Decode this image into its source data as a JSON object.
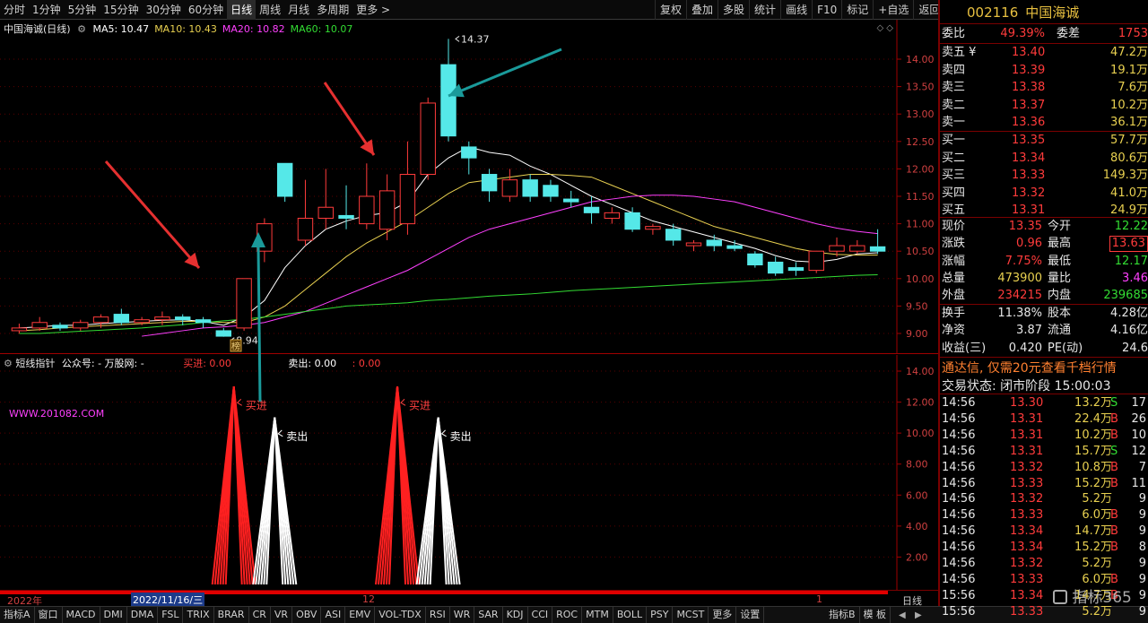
{
  "toolbar": {
    "tabs": [
      "分时",
      "1分钟",
      "5分钟",
      "15分钟",
      "30分钟",
      "60分钟",
      "日线",
      "周线",
      "月线",
      "多周期",
      "更多 >"
    ],
    "active_tab": "日线",
    "tools": [
      "复权",
      "叠加",
      "多股",
      "统计",
      "画线",
      "F10",
      "标记",
      "+自选",
      "返回"
    ]
  },
  "main": {
    "title": "中国海诚(日线)",
    "ma": [
      {
        "label": "MA5: 10.47",
        "color": "#ffffff"
      },
      {
        "label": "MA10: 10.43",
        "color": "#e8d050"
      },
      {
        "label": "MA20: 10.82",
        "color": "#ff40ff"
      },
      {
        "label": "MA60: 10.07",
        "color": "#33dd33"
      }
    ],
    "high_label": "14.37",
    "low_label": "8.94",
    "badge": "榜",
    "y_ticks": [
      "14.00",
      "13.50",
      "13.00",
      "12.50",
      "12.00",
      "11.50",
      "11.00",
      "10.50",
      "10.00",
      "9.50",
      "9.00"
    ],
    "y_values": [
      14.0,
      13.5,
      13.0,
      12.5,
      12.0,
      11.5,
      11.0,
      10.5,
      10.0,
      9.5,
      9.0
    ],
    "colors": {
      "up": "#ff3b3b",
      "down": "#55e8e8",
      "arrow_red": "#e53030",
      "arrow_teal": "#1a9a9a"
    },
    "candles": [
      [
        9.05,
        9.1,
        9.0,
        9.18
      ],
      [
        9.1,
        9.2,
        9.05,
        9.3
      ],
      [
        9.15,
        9.1,
        9.05,
        9.2
      ],
      [
        9.1,
        9.2,
        9.05,
        9.25
      ],
      [
        9.2,
        9.3,
        9.1,
        9.35
      ],
      [
        9.35,
        9.2,
        9.15,
        9.45
      ],
      [
        9.2,
        9.25,
        9.15,
        9.3
      ],
      [
        9.25,
        9.3,
        9.15,
        9.4
      ],
      [
        9.3,
        9.25,
        9.15,
        9.35
      ],
      [
        9.25,
        9.2,
        9.1,
        9.3
      ],
      [
        9.05,
        8.95,
        8.94,
        9.1
      ],
      [
        9.1,
        10.0,
        9.05,
        10.0
      ],
      [
        10.5,
        11.0,
        10.3,
        11.1
      ],
      [
        12.1,
        11.5,
        11.4,
        12.1
      ],
      [
        10.7,
        11.1,
        10.6,
        11.8
      ],
      [
        11.1,
        11.3,
        10.9,
        12.0
      ],
      [
        11.15,
        11.1,
        10.9,
        11.7
      ],
      [
        11.0,
        11.5,
        10.9,
        12.1
      ],
      [
        10.9,
        11.6,
        10.7,
        11.9
      ],
      [
        11.0,
        11.9,
        10.8,
        12.5
      ],
      [
        11.9,
        13.2,
        11.8,
        13.3
      ],
      [
        13.9,
        12.6,
        12.5,
        14.37
      ],
      [
        12.4,
        12.2,
        11.9,
        12.5
      ],
      [
        11.9,
        11.6,
        11.4,
        12.0
      ],
      [
        11.5,
        11.8,
        11.4,
        12.0
      ],
      [
        11.8,
        11.5,
        11.4,
        11.9
      ],
      [
        11.7,
        11.5,
        11.4,
        11.8
      ],
      [
        11.45,
        11.4,
        11.3,
        11.6
      ],
      [
        11.3,
        11.2,
        11.0,
        11.5
      ],
      [
        11.1,
        11.2,
        11.0,
        11.3
      ],
      [
        11.2,
        10.9,
        10.85,
        11.3
      ],
      [
        10.9,
        10.95,
        10.8,
        11.0
      ],
      [
        10.9,
        10.7,
        10.6,
        11.0
      ],
      [
        10.6,
        10.65,
        10.5,
        10.7
      ],
      [
        10.7,
        10.6,
        10.5,
        10.8
      ],
      [
        10.6,
        10.55,
        10.5,
        10.7
      ],
      [
        10.45,
        10.25,
        10.2,
        10.5
      ],
      [
        10.3,
        10.1,
        10.05,
        10.4
      ],
      [
        10.2,
        10.15,
        10.05,
        10.3
      ],
      [
        10.15,
        10.5,
        10.1,
        10.5
      ],
      [
        10.5,
        10.6,
        10.4,
        10.75
      ],
      [
        10.5,
        10.6,
        10.45,
        10.7
      ],
      [
        10.58,
        10.5,
        10.45,
        10.9
      ]
    ],
    "ma_series": {
      "ma5": [
        9.1,
        9.12,
        9.15,
        9.15,
        9.18,
        9.2,
        9.22,
        9.24,
        9.25,
        9.22,
        9.15,
        9.3,
        9.6,
        10.2,
        10.6,
        10.9,
        11.05,
        11.15,
        11.2,
        11.4,
        11.9,
        12.2,
        12.4,
        12.3,
        12.25,
        12.05,
        11.9,
        11.7,
        11.5,
        11.35,
        11.2,
        11.05,
        10.95,
        10.85,
        10.75,
        10.65,
        10.55,
        10.42,
        10.32,
        10.3,
        10.35,
        10.45,
        10.47
      ],
      "ma10": [
        9.05,
        9.07,
        9.1,
        9.12,
        9.14,
        9.16,
        9.18,
        9.2,
        9.22,
        9.22,
        9.2,
        9.2,
        9.3,
        9.5,
        9.8,
        10.1,
        10.4,
        10.65,
        10.85,
        11.05,
        11.3,
        11.55,
        11.75,
        11.8,
        11.85,
        11.9,
        11.9,
        11.88,
        11.85,
        11.7,
        11.55,
        11.4,
        11.25,
        11.1,
        10.95,
        10.85,
        10.75,
        10.65,
        10.55,
        10.48,
        10.44,
        10.43,
        10.43
      ],
      "ma20": [
        null,
        null,
        null,
        null,
        null,
        null,
        8.95,
        9.0,
        9.05,
        9.1,
        9.12,
        9.15,
        9.2,
        9.3,
        9.4,
        9.55,
        9.7,
        9.85,
        10.0,
        10.15,
        10.35,
        10.55,
        10.75,
        10.9,
        11.0,
        11.1,
        11.2,
        11.3,
        11.4,
        11.45,
        11.5,
        11.52,
        11.52,
        11.5,
        11.45,
        11.4,
        11.3,
        11.2,
        11.1,
        11.0,
        10.92,
        10.86,
        10.82
      ],
      "ma60": [
        9.0,
        9.0,
        9.02,
        9.04,
        9.06,
        9.08,
        9.1,
        9.13,
        9.16,
        9.2,
        9.23,
        9.26,
        9.3,
        9.35,
        9.4,
        9.45,
        9.5,
        9.52,
        9.54,
        9.56,
        9.6,
        9.62,
        9.65,
        9.68,
        9.7,
        9.72,
        9.75,
        9.78,
        9.8,
        9.82,
        9.84,
        9.86,
        9.88,
        9.9,
        9.92,
        9.94,
        9.96,
        9.98,
        10.0,
        10.02,
        10.04,
        10.06,
        10.07
      ]
    }
  },
  "sub": {
    "name": "短线指针",
    "publisher": "公众号: - 万股网: -",
    "buy": "买进: 0.00",
    "sell": "卖出: 0.00",
    "extra": ": 0.00",
    "watermark": "WWW.201082.COM",
    "buy_label": "买进",
    "sell_label": "卖出",
    "y_ticks": [
      "14.00",
      "12.00",
      "10.00",
      "8.00",
      "6.00",
      "4.00",
      "2.00"
    ],
    "y_values": [
      14,
      12,
      10,
      8,
      6,
      4,
      2
    ],
    "signals": [
      {
        "type": "buy",
        "index": 10.5,
        "value": 13
      },
      {
        "type": "sell",
        "index": 12.5,
        "value": 11
      },
      {
        "type": "buy",
        "index": 18.5,
        "value": 13
      },
      {
        "type": "sell",
        "index": 20.5,
        "value": 11
      }
    ]
  },
  "dates": {
    "year": "2022年",
    "cursor": "2022/11/16/三",
    "month_12": "12",
    "month_1": "1",
    "period": "日线"
  },
  "bottom_tabs": [
    "指标A",
    "窗口",
    "MACD",
    "DMI",
    "DMA",
    "FSL",
    "TRIX",
    "BRAR",
    "CR",
    "VR",
    "OBV",
    "ASI",
    "EMV",
    "VOL-TDX",
    "RSI",
    "WR",
    "SAR",
    "KDJ",
    "CCI",
    "ROC",
    "MTM",
    "BOLL",
    "PSY",
    "MCST",
    "更多",
    "设置"
  ],
  "bottom_right": [
    "指标B",
    "模 板"
  ],
  "quote": {
    "code": "002116",
    "name": "中国海诚",
    "weibi_label": "委比",
    "weibi": "49.39%",
    "weicha_label": "委差",
    "weicha": "1753",
    "asks": [
      {
        "label": "卖五 ¥",
        "price": "13.40",
        "vol": "47.2万"
      },
      {
        "label": "卖四",
        "price": "13.39",
        "vol": "19.1万"
      },
      {
        "label": "卖三",
        "price": "13.38",
        "vol": "7.6万"
      },
      {
        "label": "卖二",
        "price": "13.37",
        "vol": "10.2万"
      },
      {
        "label": "卖一",
        "price": "13.36",
        "vol": "36.1万"
      }
    ],
    "bids": [
      {
        "label": "买一",
        "price": "13.35",
        "vol": "57.7万"
      },
      {
        "label": "买二",
        "price": "13.34",
        "vol": "80.6万"
      },
      {
        "label": "买三",
        "price": "13.33",
        "vol": "149.3万"
      },
      {
        "label": "买四",
        "price": "13.32",
        "vol": "41.0万"
      },
      {
        "label": "买五",
        "price": "13.31",
        "vol": "24.9万"
      }
    ],
    "stats": [
      {
        "l1": "现价",
        "v1": "13.35",
        "l2": "今开",
        "v2": "12.22"
      },
      {
        "l1": "涨跌",
        "v1": "0.96",
        "l2": "最高",
        "v2": "13.63"
      },
      {
        "l1": "涨幅",
        "v1": "7.75%",
        "l2": "最低",
        "v2": "12.17"
      },
      {
        "l1": "总量",
        "v1": "473900",
        "l2": "量比",
        "v2": "3.46"
      },
      {
        "l1": "外盘",
        "v1": "234215",
        "l2": "内盘",
        "v2": "239685"
      }
    ],
    "fin": [
      {
        "l1": "换手",
        "v1": "11.38%",
        "l2": "股本",
        "v2": "4.28亿"
      },
      {
        "l1": "净资",
        "v1": "3.87",
        "l2": "流通",
        "v2": "4.16亿"
      },
      {
        "l1": "收益(三)",
        "v1": "0.420",
        "l2": "PE(动)",
        "v2": "24.6"
      }
    ],
    "promo": "通达信, 仅需20元查看千档行情",
    "status": "交易状态: 闭市阶段 15:00:03",
    "ticks": [
      {
        "t": "14:56",
        "p": "13.30",
        "v": "13.2万",
        "s": "S",
        "n": "17"
      },
      {
        "t": "14:56",
        "p": "13.31",
        "v": "22.4万",
        "s": "B",
        "n": "26"
      },
      {
        "t": "14:56",
        "p": "13.31",
        "v": "10.2万",
        "s": "B",
        "n": "10"
      },
      {
        "t": "14:56",
        "p": "13.31",
        "v": "15.7万",
        "s": "S",
        "n": "12"
      },
      {
        "t": "14:56",
        "p": "13.32",
        "v": "10.8万",
        "s": "B",
        "n": "7"
      },
      {
        "t": "14:56",
        "p": "13.33",
        "v": "15.2万",
        "s": "B",
        "n": "11"
      },
      {
        "t": "14:56",
        "p": "13.32",
        "v": "5.2万",
        "s": "",
        "n": "9"
      },
      {
        "t": "14:56",
        "p": "13.33",
        "v": "6.0万",
        "s": "B",
        "n": "9"
      },
      {
        "t": "14:56",
        "p": "13.34",
        "v": "14.7万",
        "s": "B",
        "n": "9"
      },
      {
        "t": "14:56",
        "p": "13.34",
        "v": "15.2万",
        "s": "B",
        "n": "8"
      },
      {
        "t": "14:56",
        "p": "13.32",
        "v": "5.2万",
        "s": "",
        "n": "9"
      },
      {
        "t": "14:56",
        "p": "13.33",
        "v": "6.0万",
        "s": "B",
        "n": "9"
      },
      {
        "t": "15:56",
        "p": "13.34",
        "v": "14.7万",
        "s": "B",
        "n": "9"
      },
      {
        "t": "15:56",
        "p": "13.33",
        "v": "5.2万",
        "s": "",
        "n": "9"
      }
    ]
  },
  "logo_text": "指标365"
}
